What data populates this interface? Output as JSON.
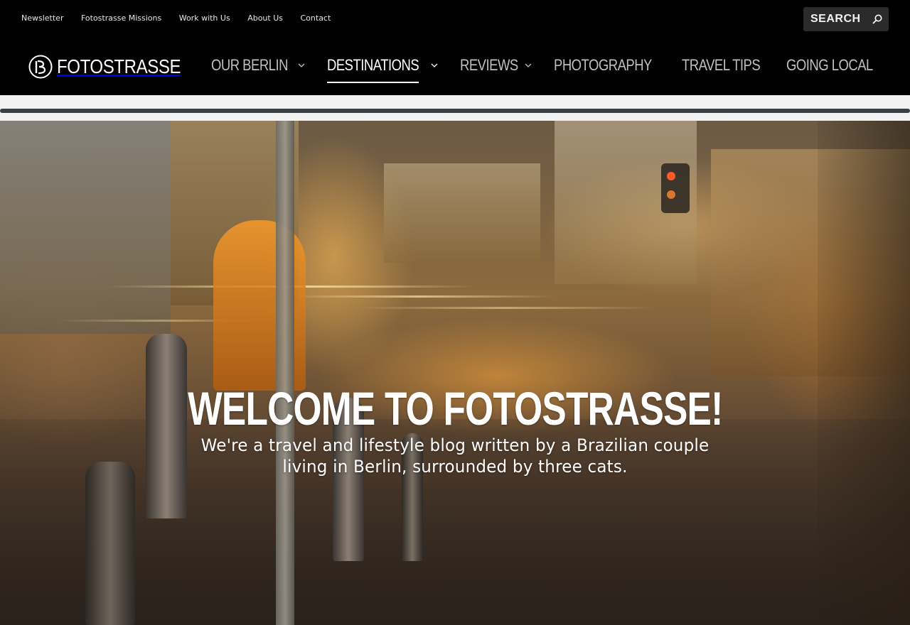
{
  "top_links": [
    {
      "label": "Newsletter"
    },
    {
      "label": "Fotostrasse Missions"
    },
    {
      "label": "Work with Us"
    },
    {
      "label": "About Us"
    },
    {
      "label": "Contact"
    }
  ],
  "search": {
    "placeholder": "SEARCH",
    "icon": "search-icon"
  },
  "logo": {
    "text": "FOTOSTRASSE",
    "icon": "fotostrasse-logo-icon"
  },
  "nav": [
    {
      "label": "OUR BERLIN",
      "has_dropdown": true,
      "active": false
    },
    {
      "label": "DESTINATIONS",
      "has_dropdown": true,
      "active": true
    },
    {
      "label": "REVIEWS",
      "has_dropdown": true,
      "active": false
    },
    {
      "label": "PHOTOGRAPHY",
      "has_dropdown": false,
      "active": false
    },
    {
      "label": "TRAVEL TIPS",
      "has_dropdown": false,
      "active": false
    },
    {
      "label": "GOING LOCAL",
      "has_dropdown": false,
      "active": false
    }
  ],
  "hero": {
    "title": "WELCOME TO FOTOSTRASSE!",
    "subtitle": "We're a travel and lifestyle blog written by a Brazilian couple living in Berlin, surrounded by three cats."
  },
  "colors": {
    "header_bg": "#000000",
    "nav_text": "#bfbfbf",
    "nav_active": "#ffffff",
    "separator": "#3a3f43",
    "search_bg": "#2b2b2b"
  }
}
